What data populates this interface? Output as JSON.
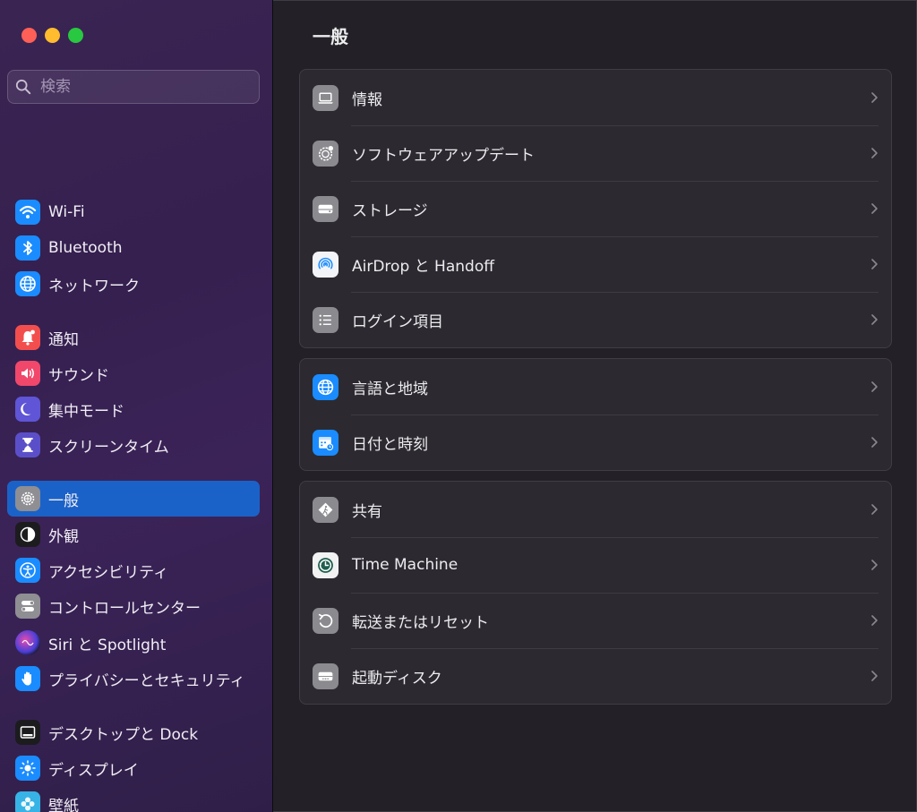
{
  "window": {
    "title": "一般"
  },
  "search": {
    "placeholder": "検索",
    "value": ""
  },
  "sidebar": {
    "items": [
      {
        "label": "Wi-Fi",
        "icon": "wifi-icon",
        "color": "#1a8cff"
      },
      {
        "label": "Bluetooth",
        "icon": "bluetooth-icon",
        "color": "#1a8cff"
      },
      {
        "label": "ネットワーク",
        "icon": "globe-icon",
        "color": "#1a8cff"
      },
      {
        "label": "通知",
        "icon": "bell-icon",
        "color": "#f34e4e"
      },
      {
        "label": "サウンド",
        "icon": "speaker-icon",
        "color": "#f0476b"
      },
      {
        "label": "集中モード",
        "icon": "moon-icon",
        "color": "#5f55d6"
      },
      {
        "label": "スクリーンタイム",
        "icon": "hourglass-icon",
        "color": "#5b4fc9"
      },
      {
        "label": "一般",
        "icon": "gear-icon",
        "color": "#8e8e93",
        "selected": true
      },
      {
        "label": "外観",
        "icon": "appearance-icon",
        "color": "#1c1c1e"
      },
      {
        "label": "アクセシビリティ",
        "icon": "accessibility-icon",
        "color": "#1a8cff"
      },
      {
        "label": "コントロールセンター",
        "icon": "control-center-icon",
        "color": "#8e8e93"
      },
      {
        "label": "Siri と Spotlight",
        "icon": "siri-icon",
        "color": "#6b3fd4"
      },
      {
        "label": "プライバシーとセキュリティ",
        "icon": "hand-icon",
        "color": "#1a8cff"
      },
      {
        "label": "デスクトップと Dock",
        "icon": "dock-icon",
        "color": "#1c1c1e"
      },
      {
        "label": "ディスプレイ",
        "icon": "sun-icon",
        "color": "#1a8cff"
      },
      {
        "label": "壁紙",
        "icon": "flower-icon",
        "color": "#37b3e6"
      }
    ]
  },
  "main": {
    "title": "一般",
    "groups": [
      {
        "rows": [
          {
            "label": "情報",
            "icon": "laptop-icon"
          },
          {
            "label": "ソフトウェアアップデート",
            "icon": "gear-badge-icon"
          },
          {
            "label": "ストレージ",
            "icon": "drive-icon"
          },
          {
            "label": "AirDrop と Handoff",
            "icon": "airdrop-icon"
          },
          {
            "label": "ログイン項目",
            "icon": "list-icon"
          }
        ]
      },
      {
        "rows": [
          {
            "label": "言語と地域",
            "icon": "globe-icon"
          },
          {
            "label": "日付と時刻",
            "icon": "calendar-clock-icon"
          }
        ]
      },
      {
        "rows": [
          {
            "label": "共有",
            "icon": "sharing-icon"
          },
          {
            "label": "Time Machine",
            "icon": "time-machine-icon"
          },
          {
            "label": "転送またはリセット",
            "icon": "reset-icon"
          },
          {
            "label": "起動ディスク",
            "icon": "startup-disk-icon"
          }
        ]
      }
    ]
  }
}
